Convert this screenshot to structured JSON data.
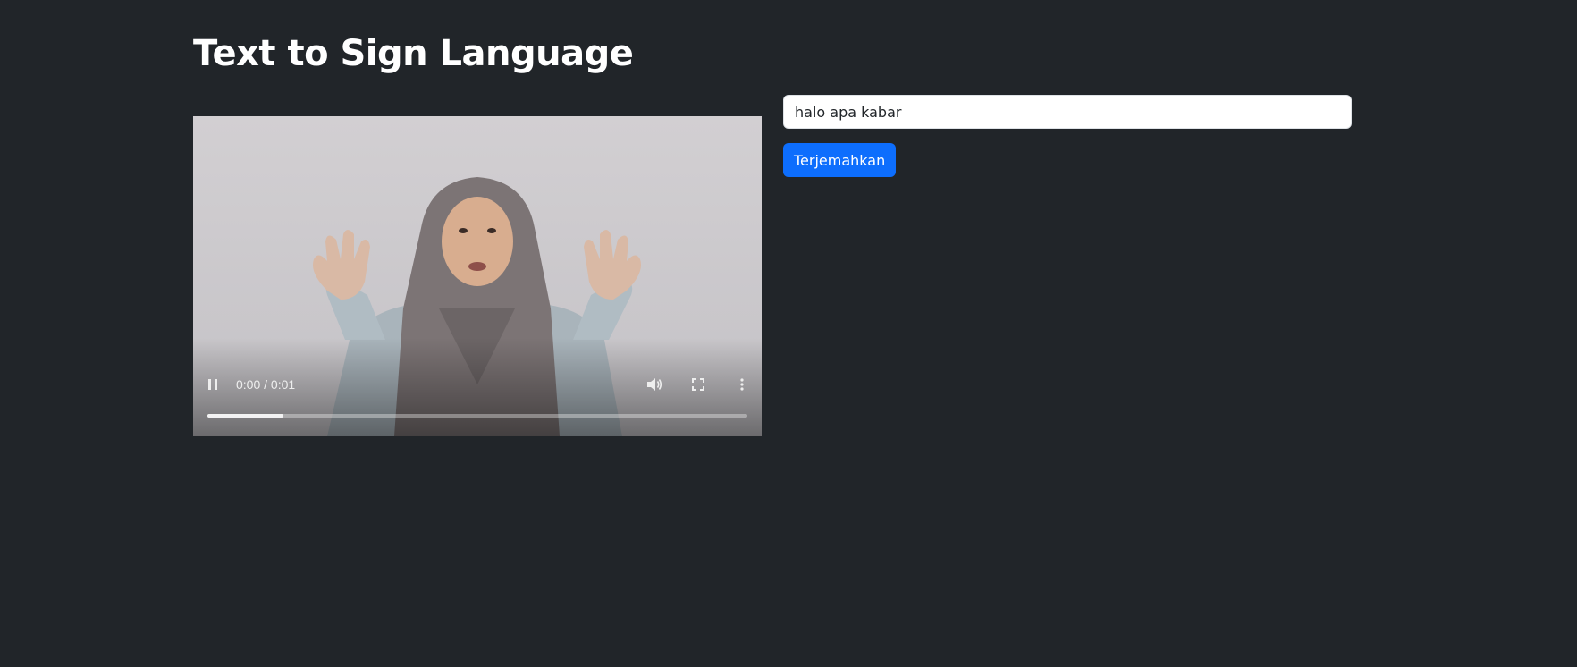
{
  "page": {
    "title": "Text to Sign Language"
  },
  "video": {
    "time_display": "0:00 / 0:01",
    "progress_fraction": 0.14,
    "state": "playing",
    "icons": {
      "pause": "pause-icon",
      "volume": "volume-icon",
      "fullscreen": "fullscreen-icon",
      "more": "more-vertical-icon"
    }
  },
  "form": {
    "input_value": "halo apa kabar",
    "input_placeholder": "",
    "submit_label": "Terjemahkan"
  },
  "colors": {
    "background": "#212529",
    "primary_button": "#0d6efd",
    "title_text": "#ffffff"
  }
}
